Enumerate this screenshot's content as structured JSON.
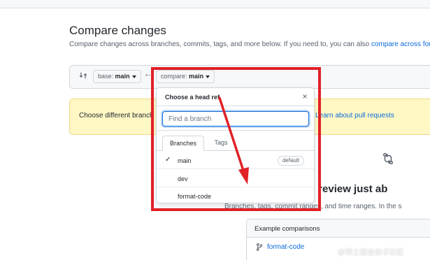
{
  "page": {
    "title": "Compare changes",
    "description_prefix": "Compare changes across branches, commits, tags, and more below. If you need to, you can also ",
    "description_link": "compare across forks."
  },
  "range": {
    "base_label": "base:",
    "base_value": "main",
    "compare_label": "compare:",
    "compare_value": "main"
  },
  "flash": {
    "text": "Choose different branch",
    "link": "Learn about pull requests"
  },
  "blankslate": {
    "title": "re and review just ab",
    "description": "Branches, tags, commit ranges, and time ranges. In the s"
  },
  "examples": {
    "header": "Example comparisons",
    "rows": [
      "format-code"
    ]
  },
  "dropdown": {
    "title": "Choose a head ref",
    "close_glyph": "×",
    "filter_placeholder": "Find a branch",
    "tabs": {
      "branches": "Branches",
      "tags": "Tags"
    },
    "items": [
      {
        "name": "main",
        "selected": true,
        "badge": "default"
      },
      {
        "name": "dev"
      },
      {
        "name": "format-code"
      }
    ],
    "check_glyph": "✓"
  },
  "watermark": "@稀土掘金技术社区",
  "colors": {
    "annotation": "#e02126",
    "link": "#0969da",
    "flash_bg": "#fff8c5"
  },
  "icons": {
    "range": "git-compare-icon",
    "swap": "arrow-left-icon",
    "example": "git-branch-icon"
  }
}
